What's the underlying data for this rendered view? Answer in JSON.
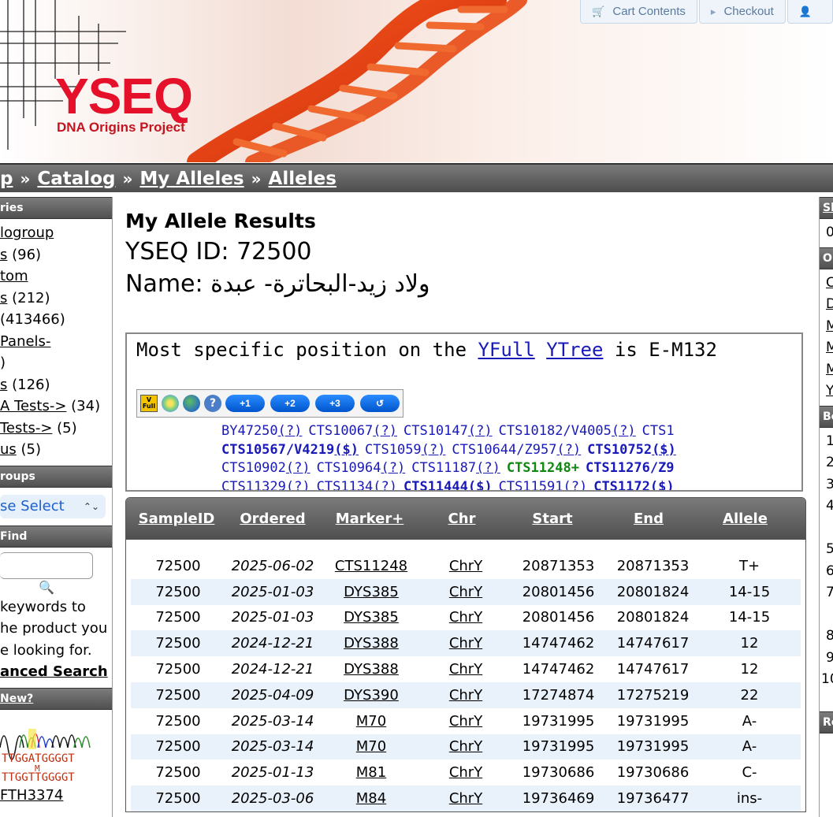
{
  "header": {
    "logo_text": "YSEQ",
    "logo_sub": "DNA Origins Project",
    "buttons": [
      {
        "label": "Cart Contents",
        "icon": "cart-icon"
      },
      {
        "label": "Checkout",
        "icon": "arrow-right-icon"
      },
      {
        "label": "",
        "icon": "user-icon"
      }
    ]
  },
  "breadcrumb": {
    "items": [
      "p",
      "Catalog",
      "My Alleles",
      "Alleles"
    ],
    "separator": "»"
  },
  "left": {
    "categories_title": "ries",
    "categories": [
      {
        "link": "logroup",
        "count": ""
      },
      {
        "link": "s",
        "count": " (96)"
      },
      {
        "link": "tom",
        "count": ""
      },
      {
        "link": "s",
        "count": " (212)"
      },
      {
        "link": "",
        "count": "(413466)"
      },
      {
        "link": " Panels-",
        "count": ""
      },
      {
        "link": "",
        "count": ")"
      },
      {
        "link": "s",
        "count": " (126)"
      },
      {
        "link": "A Tests->",
        "count": " (34)"
      },
      {
        "link": "Tests->",
        "count": " (5)"
      },
      {
        "link": "us",
        "count": " (5)"
      }
    ],
    "groups_title": "roups",
    "groups_select": "se Select",
    "find_title": "Find",
    "find_hint": [
      " keywords to",
      "he product you",
      "e looking for."
    ],
    "advanced_search": "anced Search",
    "whats_new_title": " New?",
    "new_product_link": "FTH3374"
  },
  "right": {
    "heads": [
      "Sh",
      "O",
      "Be",
      "Re"
    ],
    "list1": [
      "0"
    ],
    "list2": [
      "C",
      "D",
      "M",
      "M",
      "M",
      "Y"
    ],
    "list3": [
      "1",
      "2",
      "3",
      "4",
      "",
      "5",
      "6",
      "7",
      "",
      "8",
      "9",
      "10"
    ]
  },
  "main": {
    "title": "My Allele Results",
    "yseq_id_label": "YSEQ ID:",
    "yseq_id": "72500",
    "name_label": "Name:",
    "name_value": "ولاد زيد-البحاترة- عبدة",
    "position": {
      "prefix": "Most specific position on the ",
      "link1": "YFull",
      "link2": "YTree",
      "suffix": " is E-M132"
    },
    "toolbar_buttons": [
      "+1",
      "+2",
      "+3",
      "↺"
    ],
    "snps": [
      [
        {
          "name": "BY47250",
          "tag": "(?)",
          "style": "normal"
        },
        {
          "name": "CTS10067",
          "tag": "(?)",
          "style": "normal"
        },
        {
          "name": "CTS10147",
          "tag": "(?)",
          "style": "normal"
        },
        {
          "name": "CTS10182/V4005",
          "tag": "(?)",
          "style": "normal"
        },
        {
          "name": "CTS1",
          "tag": "",
          "style": "normal"
        }
      ],
      [
        {
          "name": "CTS10567/V4219",
          "tag": "($)",
          "style": "bold"
        },
        {
          "name": "CTS1059",
          "tag": "(?)",
          "style": "normal"
        },
        {
          "name": "CTS10644/Z957",
          "tag": "(?)",
          "style": "normal"
        },
        {
          "name": "CTS10752",
          "tag": "($)",
          "style": "bold"
        }
      ],
      [
        {
          "name": "CTS10902",
          "tag": "(?)",
          "style": "normal"
        },
        {
          "name": "CTS10964",
          "tag": "(?)",
          "style": "normal"
        },
        {
          "name": "CTS11187",
          "tag": "(?)",
          "style": "normal"
        },
        {
          "name": "CTS11248+",
          "tag": "",
          "style": "positive"
        },
        {
          "name": "CTS11276/Z9",
          "tag": "",
          "style": "bold"
        }
      ],
      [
        {
          "name": "CTS11329",
          "tag": "(?)",
          "style": "normal"
        },
        {
          "name": "CTS1134",
          "tag": "(?)",
          "style": "normal"
        },
        {
          "name": "CTS11444",
          "tag": "($)",
          "style": "bold"
        },
        {
          "name": "CTS11591",
          "tag": "(?)",
          "style": "normal"
        },
        {
          "name": "CTS1172",
          "tag": "($)",
          "style": "bold"
        }
      ]
    ],
    "table": {
      "headers": [
        "SampleID",
        "Ordered",
        "Marker+",
        "Chr",
        "Start",
        "End",
        "Allele"
      ],
      "rows": [
        [
          "72500",
          "2025-06-02",
          "CTS11248",
          "ChrY",
          "20871353",
          "20871353",
          "T+"
        ],
        [
          "72500",
          "2025-01-03",
          "DYS385",
          "ChrY",
          "20801456",
          "20801824",
          "14-15"
        ],
        [
          "72500",
          "2025-01-03",
          "DYS385",
          "ChrY",
          "20801456",
          "20801824",
          "14-15"
        ],
        [
          "72500",
          "2024-12-21",
          "DYS388",
          "ChrY",
          "14747462",
          "14747617",
          "12"
        ],
        [
          "72500",
          "2024-12-21",
          "DYS388",
          "ChrY",
          "14747462",
          "14747617",
          "12"
        ],
        [
          "72500",
          "2025-04-09",
          "DYS390",
          "ChrY",
          "17274874",
          "17275219",
          "22"
        ],
        [
          "72500",
          "2025-03-14",
          "M70",
          "ChrY",
          "19731995",
          "19731995",
          "A-"
        ],
        [
          "72500",
          "2025-03-14",
          "M70",
          "ChrY",
          "19731995",
          "19731995",
          "A-"
        ],
        [
          "72500",
          "2025-01-13",
          "M81",
          "ChrY",
          "19730686",
          "19730686",
          "C-"
        ],
        [
          "72500",
          "2025-03-06",
          "M84",
          "ChrY",
          "19736469",
          "19736477",
          "ins-"
        ]
      ]
    }
  },
  "colors": {
    "brand_red": "#e5112a",
    "link_blue": "#1a1ab8",
    "positive_green": "#118811",
    "row_alt": "#e9f1fb"
  }
}
